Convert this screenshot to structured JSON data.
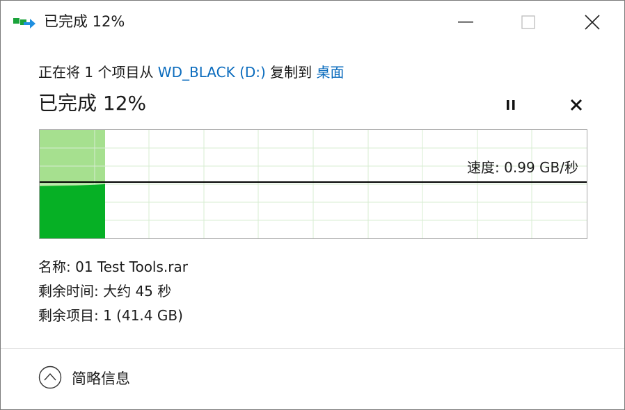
{
  "titlebar": {
    "title": "已完成 12%",
    "icon": "copy-files-icon"
  },
  "window_controls": {
    "minimize_icon": "minimize-icon",
    "maximize_icon": "maximize-icon",
    "close_icon": "close-icon"
  },
  "header": {
    "desc_prefix": "正在将 1 个项目从 ",
    "source": "WD_BLACK (D:)",
    "desc_middle": " 复制到 ",
    "destination": "桌面",
    "status": "已完成 12%",
    "pause_icon": "pause-icon",
    "cancel_icon": "cancel-icon"
  },
  "progress": {
    "percent": 12
  },
  "graph": {
    "speed_label": "速度: 0.99 GB/秒",
    "colors": {
      "progress_fill": "#a6e08f",
      "speed_fill": "#06b025",
      "grid": "#d7ecd2",
      "speed_line": "#000000"
    }
  },
  "details": {
    "name": "名称: 01 Test Tools.rar",
    "time_remaining": "剩余时间: 大约 45 秒",
    "items_remaining": "剩余项目: 1 (41.4 GB)"
  },
  "footer": {
    "toggle_label": "简略信息",
    "toggle_icon": "chevron-up-icon"
  }
}
